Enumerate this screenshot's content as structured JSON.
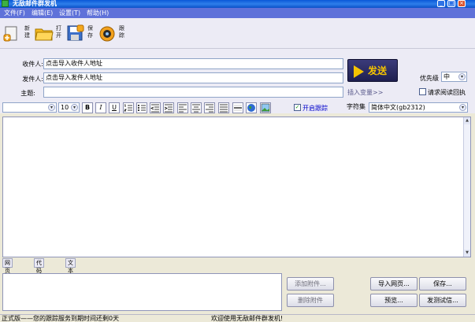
{
  "window": {
    "title": "无敌邮件群发机",
    "minimize": "_",
    "maximize": "□",
    "close": "×"
  },
  "menu": [
    {
      "label": "文件(F)"
    },
    {
      "label": "编辑(E)"
    },
    {
      "label": "设置(T)"
    },
    {
      "label": "帮助(H)"
    }
  ],
  "toolbar": {
    "new_label": "新建",
    "open_label": "打开",
    "save_label": "保存",
    "track_label": "跟踪"
  },
  "form": {
    "to_label": "收件人:",
    "to_value": "点击导入收件人地址",
    "from_label": "发件人:",
    "from_value": "点击导入发件人地址",
    "subject_label": "主题:",
    "subject_value": "",
    "send_label": "发送",
    "priority_label": "优先级",
    "priority_value": "中",
    "read_receipt_label": "请求阅读回执",
    "insert_var_link": "插入变量>>",
    "charset_label": "字符集",
    "charset_value": "简体中文(gb2312)",
    "tracking_label": "开启跟踪",
    "tracking_checked": true
  },
  "format": {
    "font_value": "",
    "size_value": "10",
    "bold": "B",
    "italic": "I",
    "underline": "U"
  },
  "view_tabs": [
    "网页视图",
    "代码视图",
    "文本视图"
  ],
  "attachments": {
    "add_label": "添加附件...",
    "remove_label": "删除附件"
  },
  "actions": {
    "import_web_label": "导入网页...",
    "save_label": "保存...",
    "preview_label": "预览...",
    "test_send_label": "发测试信..."
  },
  "status": {
    "left": "正式版——您的跟踪服务到期时间还剩0天",
    "right": "欢迎使用无敌邮件群发机!"
  },
  "colors": {
    "menubar": "#5F72D9",
    "send_text": "#F6C400",
    "send_bg": "#2A2A60"
  }
}
